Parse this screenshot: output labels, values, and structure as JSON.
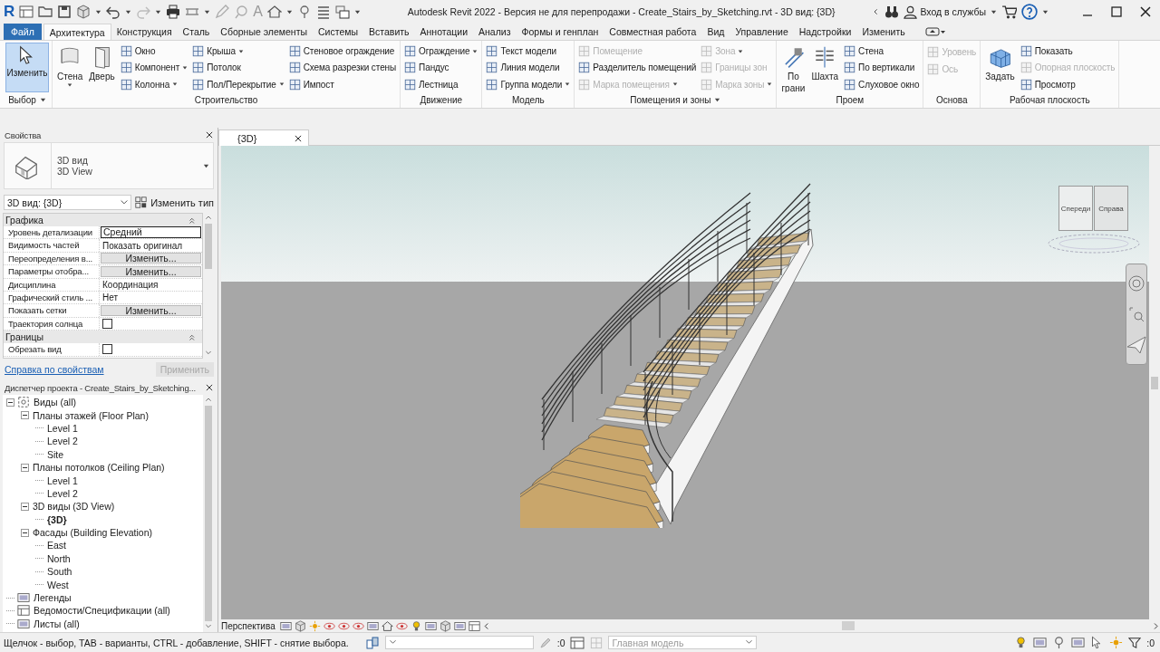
{
  "window": {
    "logo": "R",
    "title": "Autodesk Revit 2022 - Версия не для перепродажи - Create_Stairs_by_Sketching.rvt - 3D вид: {3D}",
    "text_tool": "A",
    "account": "Вход в службы"
  },
  "tabs": [
    {
      "label": "Файл",
      "kind": "file",
      "selected": false
    },
    {
      "label": "Архитектура",
      "kind": "tab",
      "selected": true
    },
    {
      "label": "Конструкция",
      "kind": "tab",
      "selected": false
    },
    {
      "label": "Сталь",
      "kind": "tab",
      "selected": false
    },
    {
      "label": "Сборные элементы",
      "kind": "tab",
      "selected": false
    },
    {
      "label": "Системы",
      "kind": "tab",
      "selected": false
    },
    {
      "label": "Вставить",
      "kind": "tab",
      "selected": false
    },
    {
      "label": "Аннотации",
      "kind": "tab",
      "selected": false
    },
    {
      "label": "Анализ",
      "kind": "tab",
      "selected": false
    },
    {
      "label": "Формы и генплан",
      "kind": "tab",
      "selected": false
    },
    {
      "label": "Совместная работа",
      "kind": "tab",
      "selected": false
    },
    {
      "label": "Вид",
      "kind": "tab",
      "selected": false
    },
    {
      "label": "Управление",
      "kind": "tab",
      "selected": false
    },
    {
      "label": "Надстройки",
      "kind": "tab",
      "selected": false
    },
    {
      "label": "Изменить",
      "kind": "tab",
      "selected": false
    }
  ],
  "ribbon": [
    {
      "title": "Выбор",
      "menu": true,
      "groups": [
        {
          "kind": "large",
          "label": "Изменить",
          "dropdown": false,
          "disabled": false,
          "selected": true
        }
      ]
    },
    {
      "title": "Строительство",
      "menu": false,
      "groups": [
        {
          "kind": "large",
          "label": "Стена",
          "dropdown": true,
          "disabled": false,
          "selected": false
        },
        {
          "kind": "large",
          "label": "Дверь",
          "dropdown": false,
          "disabled": false,
          "selected": false
        },
        {
          "kind": "stack",
          "items": [
            {
              "label": "Окно",
              "dropdown": false,
              "disabled": false
            },
            {
              "label": "Компонент",
              "dropdown": true,
              "disabled": false
            },
            {
              "label": "Колонна",
              "dropdown": true,
              "disabled": false
            }
          ]
        },
        {
          "kind": "stack",
          "items": [
            {
              "label": "Крыша",
              "dropdown": true,
              "disabled": false
            },
            {
              "label": "Потолок",
              "dropdown": false,
              "disabled": false
            },
            {
              "label": "Пол/Перекрытие",
              "dropdown": true,
              "disabled": false
            }
          ]
        },
        {
          "kind": "stack",
          "items": [
            {
              "label": "Стеновое ограждение",
              "dropdown": false,
              "disabled": false
            },
            {
              "label": "Схема разрезки стены",
              "dropdown": false,
              "disabled": false
            },
            {
              "label": "Импост",
              "dropdown": false,
              "disabled": false
            }
          ]
        }
      ]
    },
    {
      "title": "Движение",
      "menu": false,
      "groups": [
        {
          "kind": "stack",
          "items": [
            {
              "label": "Ограждение",
              "dropdown": true,
              "disabled": false
            },
            {
              "label": "Пандус",
              "dropdown": false,
              "disabled": false
            },
            {
              "label": "Лестница",
              "dropdown": false,
              "disabled": false
            }
          ]
        }
      ]
    },
    {
      "title": "Модель",
      "menu": false,
      "groups": [
        {
          "kind": "stack",
          "items": [
            {
              "label": "Текст модели",
              "dropdown": false,
              "disabled": false
            },
            {
              "label": "Линия модели",
              "dropdown": false,
              "disabled": false
            },
            {
              "label": "Группа модели",
              "dropdown": true,
              "disabled": false
            }
          ]
        }
      ]
    },
    {
      "title": "Помещения и зоны",
      "menu": true,
      "groups": [
        {
          "kind": "stack",
          "items": [
            {
              "label": "Помещение",
              "dropdown": false,
              "disabled": true
            },
            {
              "label": "Разделитель помещений",
              "dropdown": false,
              "disabled": false
            },
            {
              "label": "Марка помещения",
              "dropdown": true,
              "disabled": true
            }
          ]
        },
        {
          "kind": "stack",
          "items": [
            {
              "label": "Зона",
              "dropdown": true,
              "disabled": true
            },
            {
              "label": "Границы зон",
              "dropdown": false,
              "disabled": true
            },
            {
              "label": "Марка зоны",
              "dropdown": true,
              "disabled": true
            }
          ]
        }
      ]
    },
    {
      "title": "Проем",
      "menu": false,
      "groups": [
        {
          "kind": "large",
          "label": "По грани",
          "dropdown": false,
          "disabled": false,
          "selected": false
        },
        {
          "kind": "large",
          "label": "Шахта",
          "dropdown": false,
          "disabled": false,
          "selected": false
        },
        {
          "kind": "stack",
          "items": [
            {
              "label": "Стена",
              "dropdown": false,
              "disabled": false
            },
            {
              "label": "По вертикали",
              "dropdown": false,
              "disabled": false
            },
            {
              "label": "Слуховое окно",
              "dropdown": false,
              "disabled": false
            }
          ]
        }
      ]
    },
    {
      "title": "Основа",
      "menu": false,
      "groups": [
        {
          "kind": "stack",
          "items": [
            {
              "label": "Уровень",
              "dropdown": false,
              "disabled": true
            },
            {
              "label": "Ось",
              "dropdown": false,
              "disabled": true
            }
          ]
        }
      ]
    },
    {
      "title": "Рабочая плоскость",
      "menu": false,
      "groups": [
        {
          "kind": "large",
          "label": "Задать",
          "dropdown": false,
          "disabled": false,
          "selected": false
        },
        {
          "kind": "stack",
          "items": [
            {
              "label": "Показать",
              "dropdown": false,
              "disabled": false
            },
            {
              "label": "Опорная плоскость",
              "dropdown": false,
              "disabled": true
            },
            {
              "label": "Просмотр",
              "dropdown": false,
              "disabled": false
            }
          ]
        }
      ]
    }
  ],
  "properties": {
    "title": "Свойства",
    "type_name": "3D вид",
    "type_name_en": "3D View",
    "instance": "3D вид: {3D}",
    "edit_type": "Изменить тип",
    "sections": [
      {
        "title": "Графика",
        "expanded": true,
        "rows": [
          {
            "label": "Уровень детализации",
            "kind": "field",
            "value": "Средний"
          },
          {
            "label": "Видимость частей",
            "kind": "text",
            "value": "Показать оригинал"
          },
          {
            "label": "Переопределения в...",
            "kind": "button",
            "value": "Изменить..."
          },
          {
            "label": "Параметры отобра...",
            "kind": "button",
            "value": "Изменить..."
          },
          {
            "label": "Дисциплина",
            "kind": "text",
            "value": "Координация"
          },
          {
            "label": "Графический стиль ...",
            "kind": "text",
            "value": "Нет"
          },
          {
            "label": "Показать сетки",
            "kind": "button",
            "value": "Изменить..."
          },
          {
            "label": "Траектория солнца",
            "kind": "checkbox",
            "checked": false
          }
        ]
      },
      {
        "title": "Границы",
        "expanded": true,
        "rows": [
          {
            "label": "Обрезать вид",
            "kind": "checkbox",
            "checked": false
          }
        ]
      }
    ],
    "help_link": "Справка по свойствам",
    "apply": {
      "label": "Применить",
      "disabled": true
    }
  },
  "project_browser": {
    "title": "Диспетчер проекта - Create_Stairs_by_Sketching...",
    "tree": [
      {
        "label": "Виды (all)",
        "expanded": true,
        "children": [
          {
            "label": "Планы этажей (Floor Plan)",
            "expanded": true,
            "children": [
              {
                "label": "Level 1",
                "current": false
              },
              {
                "label": "Level 2",
                "current": false
              },
              {
                "label": "Site",
                "current": false
              }
            ]
          },
          {
            "label": "Планы потолков (Ceiling Plan)",
            "expanded": true,
            "children": [
              {
                "label": "Level 1",
                "current": false
              },
              {
                "label": "Level 2",
                "current": false
              }
            ]
          },
          {
            "label": "3D виды (3D View)",
            "expanded": true,
            "children": [
              {
                "label": "{3D}",
                "current": true
              }
            ]
          },
          {
            "label": "Фасады (Building Elevation)",
            "expanded": true,
            "children": [
              {
                "label": "East",
                "current": false
              },
              {
                "label": "North",
                "current": false
              },
              {
                "label": "South",
                "current": false
              },
              {
                "label": "West",
                "current": false
              }
            ]
          }
        ]
      },
      {
        "label": "Легенды"
      },
      {
        "label": "Ведомости/Спецификации (all)"
      },
      {
        "label": "Листы (all)"
      }
    ]
  },
  "view_tabs": [
    {
      "label": "{3D}",
      "selected": true
    }
  ],
  "viewcube": {
    "front": "Спереди",
    "right": "Справа"
  },
  "view_control": {
    "label": "Перспектива"
  },
  "status_bar": {
    "hint": "Щелчок - выбор, TAB - варианты, CTRL - добавление, SHIFT - снятие выбора.",
    "workset_count": ":0",
    "model": "Главная модель",
    "filter_count": ":0"
  }
}
